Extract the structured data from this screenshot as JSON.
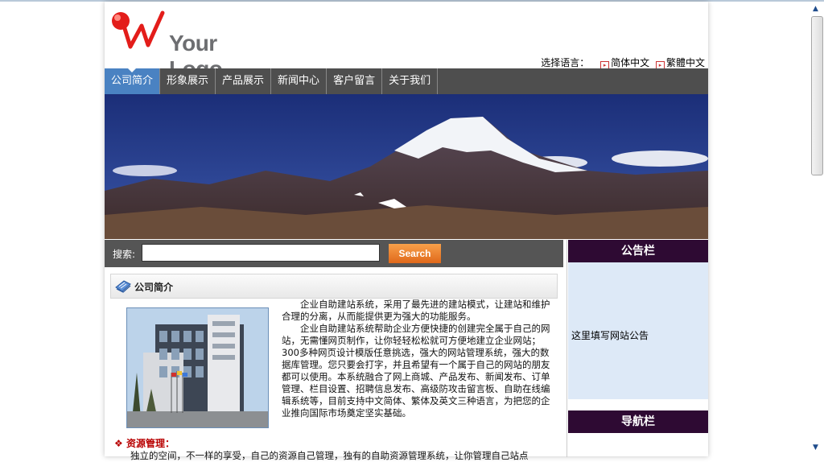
{
  "header": {
    "logo_text": "Your Logo",
    "language": {
      "label": "选择语言：",
      "options": [
        "简体中文",
        "繁體中文"
      ]
    }
  },
  "nav": {
    "items": [
      "公司简介",
      "形象展示",
      "产品展示",
      "新闻中心",
      "客户留言",
      "关于我们"
    ],
    "active_index": 0
  },
  "search": {
    "label": "搜索:",
    "value": "",
    "button": "Search"
  },
  "main": {
    "section_title": "公司简介",
    "intro_paragraphs": [
      "企业自助建站系统，采用了最先进的建站模式，让建站和维护合理的分离，从而能提供更为强大的功能服务。",
      "企业自助建站系统帮助企业方便快捷的创建完全属于自己的网站，无需懂网页制作，让你轻轻松松就可方便地建立企业网站；300多种网页设计模版任意挑选，强大的网站管理系统，强大的数据库管理。您只要会打字，并且希望有一个属于自己的网站的朋友都可以使用。本系统融合了网上商城、产品发布、新闻发布、订单管理、栏目设置、招聘信息发布、高级防攻击留言板、自助在线编辑系统等，目前支持中文简体、繁体及英文三种语言，为把您的企业推向国际市场奠定坚实基础。"
    ],
    "resource_title": "资源管理：",
    "resource_text": "独立的空间，不一样的享受，自己的资源自己管理，独有的自助资源管理系统，让你管理自己站点"
  },
  "sidebar": {
    "notice_title": "公告栏",
    "notice_text": "这里填写网站公告",
    "nav_title": "导航栏"
  },
  "colors": {
    "nav_bg": "#4e4e4e",
    "nav_active": "#4a82c2",
    "sidebar_head": "#2e0a33",
    "notice_bg": "#dde9f7",
    "search_button": "#e0681a",
    "resource_title": "#b80000"
  }
}
